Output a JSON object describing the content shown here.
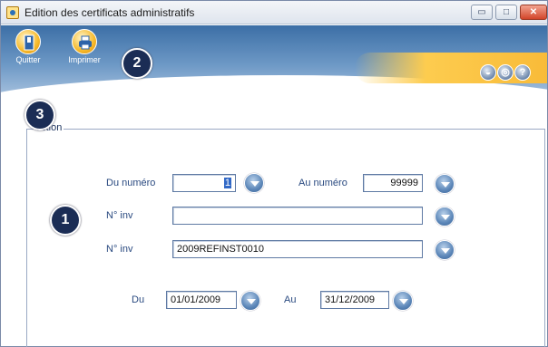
{
  "window": {
    "title": "Edition des certificats administratifs",
    "controls": {
      "minimize": "▭",
      "maximize": "□",
      "close": "✕"
    }
  },
  "toolbar": {
    "quit_label": "Quitter",
    "print_label": "Imprimer",
    "help_icons": [
      "graduation-cap-icon",
      "headset-icon",
      "help-icon"
    ],
    "help_glyphs": [
      "◒",
      "◎",
      "?"
    ]
  },
  "callouts": {
    "one": "1",
    "two": "2",
    "three": "3"
  },
  "selection": {
    "legend": "ection",
    "du_numero_label": "Du numéro",
    "du_numero_value": "1",
    "au_numero_label": "Au numéro",
    "au_numero_value": "99999",
    "ninv1_label": "N° inv",
    "ninv1_value": "",
    "ninv2_label": "N° inv",
    "ninv2_value": "2009REFINST0010",
    "du_label": "Du",
    "du_value": "01/01/2009",
    "au_label": "Au",
    "au_value": "31/12/2009"
  },
  "colors": {
    "accent": "#3c6fa6",
    "orange": "#f7b531",
    "callout": "#1b2d55"
  }
}
